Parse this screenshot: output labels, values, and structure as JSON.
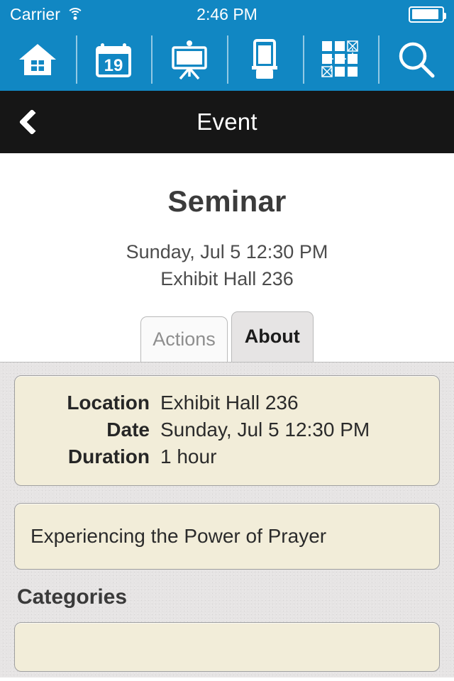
{
  "status_bar": {
    "carrier": "Carrier",
    "wifi_icon": "wifi-icon",
    "time": "2:46 PM",
    "battery_icon": "battery-full-icon"
  },
  "toolbar": {
    "items": [
      {
        "name": "home",
        "icon": "home-icon",
        "label": "Home"
      },
      {
        "name": "schedule",
        "icon": "calendar-icon",
        "label": "Schedule",
        "day": "19"
      },
      {
        "name": "sessions",
        "icon": "easel-presentation-icon",
        "label": "Sessions"
      },
      {
        "name": "exhibitors",
        "icon": "banner-stand-icon",
        "label": "Exhibitors"
      },
      {
        "name": "floorplan",
        "icon": "floorplan-grid-icon",
        "label": "Floor Plan"
      },
      {
        "name": "search",
        "icon": "search-icon",
        "label": "Search"
      }
    ]
  },
  "navbar": {
    "back_icon": "chevron-left-icon",
    "title": "Event"
  },
  "event": {
    "title": "Seminar",
    "datetime": "Sunday, Jul 5 12:30 PM",
    "location": "Exhibit Hall 236"
  },
  "tabs": [
    {
      "label": "Actions",
      "active": false
    },
    {
      "label": "About",
      "active": true
    }
  ],
  "about": {
    "info": {
      "rows": [
        {
          "label": "Location",
          "value": "Exhibit Hall 236"
        },
        {
          "label": "Date",
          "value": "Sunday, Jul 5 12:30 PM"
        },
        {
          "label": "Duration",
          "value": "1 hour"
        }
      ]
    },
    "description": "Experiencing the Power of Prayer",
    "categories_heading": "Categories"
  },
  "colors": {
    "accent_blue": "#1187c3",
    "navbar_black": "#161616",
    "content_gray": "#e6e4e4",
    "card_cream": "#f2edd9"
  }
}
